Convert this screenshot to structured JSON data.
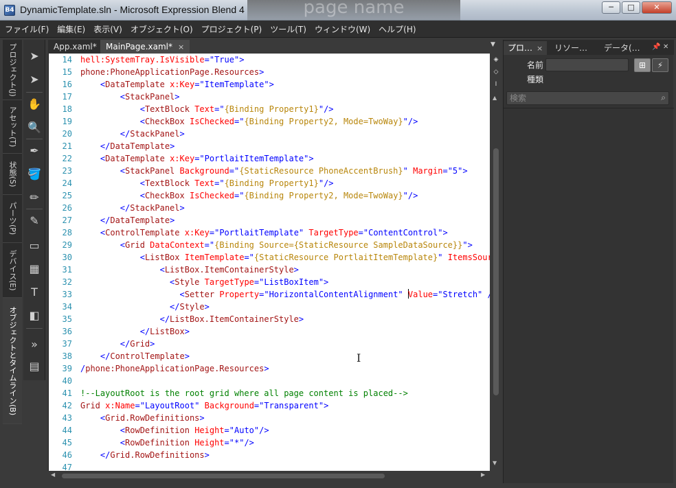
{
  "window": {
    "title": "DynamicTemplate.sln - Microsoft Expression Blend 4",
    "app_icon_text": "B4",
    "background_ghost": "page name",
    "buttons": {
      "minimize": "─",
      "maximize": "□",
      "close": "✕"
    }
  },
  "menu": [
    "ファイル(F)",
    "編集(E)",
    "表示(V)",
    "オブジェクト(O)",
    "プロジェクト(P)",
    "ツール(T)",
    "ウィンドウ(W)",
    "ヘルプ(H)"
  ],
  "left_tabs": [
    "プロジェクト(J)",
    "アセット(T)",
    "状態(S)",
    "パーツ(P)",
    "デバイス(E)",
    "オブジェクトとタイムライン(B)"
  ],
  "tools": [
    "pointer-icon",
    "direct-select-icon",
    "pan-icon",
    "zoom-icon",
    "eyedropper-icon",
    "paint-bucket-icon",
    "brush-icon",
    "pen-icon",
    "rectangle-icon",
    "grid-icon",
    "text-icon",
    "assets-icon",
    "more-icon",
    "resource-icon"
  ],
  "tool_glyphs": [
    "➤",
    "➤",
    "✋",
    "🔍",
    "✒",
    "🪣",
    "✏",
    "✎",
    "▭",
    "▦",
    "T",
    "◧",
    "»",
    "▤"
  ],
  "documents": {
    "tabs": [
      {
        "label": "App.xaml*",
        "active": false
      },
      {
        "label": "MainPage.xaml*",
        "active": true,
        "close": "×"
      }
    ],
    "dropdown": "▼"
  },
  "editor": {
    "cursor_line": 33,
    "lines": [
      {
        "n": "14",
        "parts": [
          [
            "c-attr",
            "hell:SystemTray.IsVisible"
          ],
          [
            "c-punc",
            "=\""
          ],
          [
            "c-val",
            "True"
          ],
          [
            "c-punc",
            "\">"
          ]
        ]
      },
      {
        "n": "15",
        "parts": [
          [
            "c-tag",
            "phone:PhoneApplicationPage.Resources"
          ],
          [
            "c-punc",
            ">"
          ]
        ]
      },
      {
        "n": "16",
        "parts": [
          [
            "c-txt",
            "    "
          ],
          [
            "c-punc",
            "<"
          ],
          [
            "c-tag",
            "DataTemplate"
          ],
          [
            "c-txt",
            " "
          ],
          [
            "c-attr",
            "x:Key"
          ],
          [
            "c-punc",
            "=\""
          ],
          [
            "c-val",
            "ItemTemplate"
          ],
          [
            "c-punc",
            "\">"
          ]
        ]
      },
      {
        "n": "17",
        "parts": [
          [
            "c-txt",
            "        "
          ],
          [
            "c-punc",
            "<"
          ],
          [
            "c-tag",
            "StackPanel"
          ],
          [
            "c-punc",
            ">"
          ]
        ]
      },
      {
        "n": "18",
        "parts": [
          [
            "c-txt",
            "            "
          ],
          [
            "c-punc",
            "<"
          ],
          [
            "c-tag",
            "TextBlock"
          ],
          [
            "c-txt",
            " "
          ],
          [
            "c-attr",
            "Text"
          ],
          [
            "c-punc",
            "=\""
          ],
          [
            "c-bind",
            "{Binding Property1}"
          ],
          [
            "c-punc",
            "\"/>"
          ]
        ]
      },
      {
        "n": "19",
        "parts": [
          [
            "c-txt",
            "            "
          ],
          [
            "c-punc",
            "<"
          ],
          [
            "c-tag",
            "CheckBox"
          ],
          [
            "c-txt",
            " "
          ],
          [
            "c-attr",
            "IsChecked"
          ],
          [
            "c-punc",
            "=\""
          ],
          [
            "c-bind",
            "{Binding Property2, Mode=TwoWay}"
          ],
          [
            "c-punc",
            "\"/>"
          ]
        ]
      },
      {
        "n": "20",
        "parts": [
          [
            "c-txt",
            "        "
          ],
          [
            "c-punc",
            "</"
          ],
          [
            "c-tag",
            "StackPanel"
          ],
          [
            "c-punc",
            ">"
          ]
        ]
      },
      {
        "n": "21",
        "parts": [
          [
            "c-txt",
            "    "
          ],
          [
            "c-punc",
            "</"
          ],
          [
            "c-tag",
            "DataTemplate"
          ],
          [
            "c-punc",
            ">"
          ]
        ]
      },
      {
        "n": "22",
        "parts": [
          [
            "c-txt",
            "    "
          ],
          [
            "c-punc",
            "<"
          ],
          [
            "c-tag",
            "DataTemplate"
          ],
          [
            "c-txt",
            " "
          ],
          [
            "c-attr",
            "x:Key"
          ],
          [
            "c-punc",
            "=\""
          ],
          [
            "c-val",
            "PortlaitItemTemplate"
          ],
          [
            "c-punc",
            "\">"
          ]
        ]
      },
      {
        "n": "23",
        "parts": [
          [
            "c-txt",
            "        "
          ],
          [
            "c-punc",
            "<"
          ],
          [
            "c-tag",
            "StackPanel"
          ],
          [
            "c-txt",
            " "
          ],
          [
            "c-attr",
            "Background"
          ],
          [
            "c-punc",
            "=\""
          ],
          [
            "c-bind",
            "{StaticResource PhoneAccentBrush}"
          ],
          [
            "c-punc",
            "\""
          ],
          [
            "c-txt",
            " "
          ],
          [
            "c-attr",
            "Margin"
          ],
          [
            "c-punc",
            "=\""
          ],
          [
            "c-val",
            "5"
          ],
          [
            "c-punc",
            "\">"
          ]
        ]
      },
      {
        "n": "24",
        "parts": [
          [
            "c-txt",
            "            "
          ],
          [
            "c-punc",
            "<"
          ],
          [
            "c-tag",
            "TextBlock"
          ],
          [
            "c-txt",
            " "
          ],
          [
            "c-attr",
            "Text"
          ],
          [
            "c-punc",
            "=\""
          ],
          [
            "c-bind",
            "{Binding Property1}"
          ],
          [
            "c-punc",
            "\"/>"
          ]
        ]
      },
      {
        "n": "25",
        "parts": [
          [
            "c-txt",
            "            "
          ],
          [
            "c-punc",
            "<"
          ],
          [
            "c-tag",
            "CheckBox"
          ],
          [
            "c-txt",
            " "
          ],
          [
            "c-attr",
            "IsChecked"
          ],
          [
            "c-punc",
            "=\""
          ],
          [
            "c-bind",
            "{Binding Property2, Mode=TwoWay}"
          ],
          [
            "c-punc",
            "\"/>"
          ]
        ]
      },
      {
        "n": "26",
        "parts": [
          [
            "c-txt",
            "        "
          ],
          [
            "c-punc",
            "</"
          ],
          [
            "c-tag",
            "StackPanel"
          ],
          [
            "c-punc",
            ">"
          ]
        ]
      },
      {
        "n": "27",
        "parts": [
          [
            "c-txt",
            "    "
          ],
          [
            "c-punc",
            "</"
          ],
          [
            "c-tag",
            "DataTemplate"
          ],
          [
            "c-punc",
            ">"
          ]
        ]
      },
      {
        "n": "28",
        "parts": [
          [
            "c-txt",
            "    "
          ],
          [
            "c-punc",
            "<"
          ],
          [
            "c-tag",
            "ControlTemplate"
          ],
          [
            "c-txt",
            " "
          ],
          [
            "c-attr",
            "x:Key"
          ],
          [
            "c-punc",
            "=\""
          ],
          [
            "c-val",
            "PortlaitTemplate"
          ],
          [
            "c-punc",
            "\""
          ],
          [
            "c-txt",
            " "
          ],
          [
            "c-attr",
            "TargetType"
          ],
          [
            "c-punc",
            "=\""
          ],
          [
            "c-val",
            "ContentControl"
          ],
          [
            "c-punc",
            "\">"
          ]
        ]
      },
      {
        "n": "29",
        "parts": [
          [
            "c-txt",
            "        "
          ],
          [
            "c-punc",
            "<"
          ],
          [
            "c-tag",
            "Grid"
          ],
          [
            "c-txt",
            " "
          ],
          [
            "c-attr",
            "DataContext"
          ],
          [
            "c-punc",
            "=\""
          ],
          [
            "c-bind",
            "{Binding Source={StaticResource SampleDataSource}}"
          ],
          [
            "c-punc",
            "\">"
          ]
        ]
      },
      {
        "n": "30",
        "parts": [
          [
            "c-txt",
            "            "
          ],
          [
            "c-punc",
            "<"
          ],
          [
            "c-tag",
            "ListBox"
          ],
          [
            "c-txt",
            " "
          ],
          [
            "c-attr",
            "ItemTemplate"
          ],
          [
            "c-punc",
            "=\""
          ],
          [
            "c-bind",
            "{StaticResource PortlaitItemTemplate}"
          ],
          [
            "c-punc",
            "\""
          ],
          [
            "c-txt",
            " "
          ],
          [
            "c-attr",
            "ItemsSource"
          ],
          [
            "c-punc",
            "="
          ]
        ]
      },
      {
        "n": "31",
        "parts": [
          [
            "c-txt",
            "                "
          ],
          [
            "c-punc",
            "<"
          ],
          [
            "c-tag",
            "ListBox.ItemContainerStyle"
          ],
          [
            "c-punc",
            ">"
          ]
        ]
      },
      {
        "n": "32",
        "parts": [
          [
            "c-txt",
            "                  "
          ],
          [
            "c-punc",
            "<"
          ],
          [
            "c-tag",
            "Style"
          ],
          [
            "c-txt",
            " "
          ],
          [
            "c-attr",
            "TargetType"
          ],
          [
            "c-punc",
            "=\""
          ],
          [
            "c-val",
            "ListBoxItem"
          ],
          [
            "c-punc",
            "\">"
          ]
        ]
      },
      {
        "n": "33",
        "parts": [
          [
            "c-txt",
            "                    "
          ],
          [
            "c-punc",
            "<"
          ],
          [
            "c-tag",
            "Setter"
          ],
          [
            "c-txt",
            " "
          ],
          [
            "c-attr",
            "Property"
          ],
          [
            "c-punc",
            "=\""
          ],
          [
            "c-val",
            "HorizontalContentAlignment"
          ],
          [
            "c-punc",
            "\""
          ],
          [
            "c-txt",
            " "
          ],
          [
            "caret",
            ""
          ],
          [
            "c-attr",
            "Value"
          ],
          [
            "c-punc",
            "=\""
          ],
          [
            "c-val",
            "Stretch"
          ],
          [
            "c-punc",
            "\" />"
          ]
        ]
      },
      {
        "n": "34",
        "parts": [
          [
            "c-txt",
            "                  "
          ],
          [
            "c-punc",
            "</"
          ],
          [
            "c-tag",
            "Style"
          ],
          [
            "c-punc",
            ">"
          ]
        ]
      },
      {
        "n": "35",
        "parts": [
          [
            "c-txt",
            "                "
          ],
          [
            "c-punc",
            "</"
          ],
          [
            "c-tag",
            "ListBox.ItemContainerStyle"
          ],
          [
            "c-punc",
            ">"
          ]
        ]
      },
      {
        "n": "36",
        "parts": [
          [
            "c-txt",
            "            "
          ],
          [
            "c-punc",
            "</"
          ],
          [
            "c-tag",
            "ListBox"
          ],
          [
            "c-punc",
            ">"
          ]
        ]
      },
      {
        "n": "37",
        "parts": [
          [
            "c-txt",
            "        "
          ],
          [
            "c-punc",
            "</"
          ],
          [
            "c-tag",
            "Grid"
          ],
          [
            "c-punc",
            ">"
          ]
        ]
      },
      {
        "n": "38",
        "parts": [
          [
            "c-txt",
            "    "
          ],
          [
            "c-punc",
            "</"
          ],
          [
            "c-tag",
            "ControlTemplate"
          ],
          [
            "c-punc",
            ">"
          ]
        ]
      },
      {
        "n": "39",
        "parts": [
          [
            "c-punc",
            "/"
          ],
          [
            "c-tag",
            "phone:PhoneApplicationPage.Resources"
          ],
          [
            "c-punc",
            ">"
          ]
        ]
      },
      {
        "n": "40",
        "parts": []
      },
      {
        "n": "41",
        "parts": [
          [
            "c-cmt",
            "!--LayoutRoot is the root grid where all page content is placed-->"
          ]
        ]
      },
      {
        "n": "42",
        "parts": [
          [
            "c-tag",
            "Grid"
          ],
          [
            "c-txt",
            " "
          ],
          [
            "c-attr",
            "x:Name"
          ],
          [
            "c-punc",
            "=\""
          ],
          [
            "c-val",
            "LayoutRoot"
          ],
          [
            "c-punc",
            "\""
          ],
          [
            "c-txt",
            " "
          ],
          [
            "c-attr",
            "Background"
          ],
          [
            "c-punc",
            "=\""
          ],
          [
            "c-val",
            "Transparent"
          ],
          [
            "c-punc",
            "\">"
          ]
        ]
      },
      {
        "n": "43",
        "parts": [
          [
            "c-txt",
            "    "
          ],
          [
            "c-punc",
            "<"
          ],
          [
            "c-tag",
            "Grid.RowDefinitions"
          ],
          [
            "c-punc",
            ">"
          ]
        ]
      },
      {
        "n": "44",
        "parts": [
          [
            "c-txt",
            "        "
          ],
          [
            "c-punc",
            "<"
          ],
          [
            "c-tag",
            "RowDefinition"
          ],
          [
            "c-txt",
            " "
          ],
          [
            "c-attr",
            "Height"
          ],
          [
            "c-punc",
            "=\""
          ],
          [
            "c-val",
            "Auto"
          ],
          [
            "c-punc",
            "\"/>"
          ]
        ]
      },
      {
        "n": "45",
        "parts": [
          [
            "c-txt",
            "        "
          ],
          [
            "c-punc",
            "<"
          ],
          [
            "c-tag",
            "RowDefinition"
          ],
          [
            "c-txt",
            " "
          ],
          [
            "c-attr",
            "Height"
          ],
          [
            "c-punc",
            "=\""
          ],
          [
            "c-val",
            "*"
          ],
          [
            "c-punc",
            "\"/>"
          ]
        ]
      },
      {
        "n": "46",
        "parts": [
          [
            "c-txt",
            "    "
          ],
          [
            "c-punc",
            "</"
          ],
          [
            "c-tag",
            "Grid.RowDefinitions"
          ],
          [
            "c-punc",
            ">"
          ]
        ]
      },
      {
        "n": "47",
        "parts": []
      }
    ]
  },
  "properties_panel": {
    "tabs": [
      {
        "label": "プロ…",
        "active": true,
        "close": "×"
      },
      {
        "label": "リソー…",
        "active": false
      },
      {
        "label": "データ(…",
        "active": false
      }
    ],
    "pin": "📌",
    "close": "✕",
    "name_label": "名前",
    "type_label": "種類",
    "name_value": "",
    "search_placeholder": "検索"
  },
  "colors": {
    "ui_dark": "#333333",
    "editor_bg": "#ffffff",
    "xml_tag": "#a31515",
    "xml_attr": "#ff0000",
    "xml_value": "#0000ff",
    "binding": "#b8860b",
    "comment": "#008000",
    "line_number": "#2b91af"
  }
}
